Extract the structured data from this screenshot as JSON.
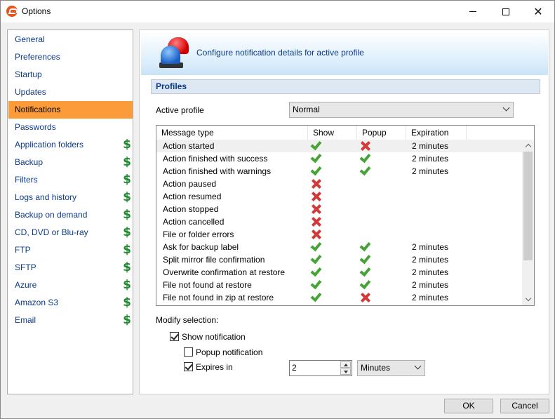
{
  "window": {
    "title": "Options"
  },
  "nav": {
    "items": [
      {
        "label": "General",
        "paid": false,
        "selected": false
      },
      {
        "label": "Preferences",
        "paid": false,
        "selected": false
      },
      {
        "label": "Startup",
        "paid": false,
        "selected": false
      },
      {
        "label": "Updates",
        "paid": false,
        "selected": false
      },
      {
        "label": "Notifications",
        "paid": false,
        "selected": true
      },
      {
        "label": "Passwords",
        "paid": false,
        "selected": false
      },
      {
        "label": "Application folders",
        "paid": true,
        "selected": false
      },
      {
        "label": "Backup",
        "paid": true,
        "selected": false
      },
      {
        "label": "Filters",
        "paid": true,
        "selected": false
      },
      {
        "label": "Logs and history",
        "paid": true,
        "selected": false
      },
      {
        "label": "Backup on demand",
        "paid": true,
        "selected": false
      },
      {
        "label": "CD, DVD or Blu-ray",
        "paid": true,
        "selected": false
      },
      {
        "label": "FTP",
        "paid": true,
        "selected": false
      },
      {
        "label": "SFTP",
        "paid": true,
        "selected": false
      },
      {
        "label": "Azure",
        "paid": true,
        "selected": false
      },
      {
        "label": "Amazon S3",
        "paid": true,
        "selected": false
      },
      {
        "label": "Email",
        "paid": true,
        "selected": false
      }
    ],
    "paid_symbol": "$"
  },
  "banner": {
    "icon": "siren-icon",
    "text": "Configure notification details for active profile"
  },
  "profiles": {
    "section_title": "Profiles",
    "active_profile_label": "Active profile",
    "active_profile_value": "Normal"
  },
  "table": {
    "columns": [
      "Message type",
      "Show",
      "Popup",
      "Expiration"
    ],
    "rows": [
      {
        "type": "Action started",
        "show": "check",
        "popup": "cross",
        "expiration": "2 minutes",
        "highlight": true
      },
      {
        "type": "Action finished with success",
        "show": "check",
        "popup": "check",
        "expiration": "2 minutes"
      },
      {
        "type": "Action finished with warnings",
        "show": "check",
        "popup": "check",
        "expiration": "2 minutes"
      },
      {
        "type": "Action paused",
        "show": "cross",
        "popup": "",
        "expiration": ""
      },
      {
        "type": "Action resumed",
        "show": "cross",
        "popup": "",
        "expiration": ""
      },
      {
        "type": "Action stopped",
        "show": "cross",
        "popup": "",
        "expiration": ""
      },
      {
        "type": "Action cancelled",
        "show": "cross",
        "popup": "",
        "expiration": ""
      },
      {
        "type": "File or folder errors",
        "show": "cross",
        "popup": "",
        "expiration": ""
      },
      {
        "type": "Ask for backup label",
        "show": "check",
        "popup": "check",
        "expiration": "2 minutes"
      },
      {
        "type": "Split mirror file confirmation",
        "show": "check",
        "popup": "check",
        "expiration": "2 minutes"
      },
      {
        "type": "Overwrite confirmation at restore",
        "show": "check",
        "popup": "check",
        "expiration": "2 minutes"
      },
      {
        "type": "File not found at restore",
        "show": "check",
        "popup": "check",
        "expiration": "2 minutes"
      },
      {
        "type": "File not found in zip at restore",
        "show": "check",
        "popup": "cross",
        "expiration": "2 minutes"
      }
    ]
  },
  "modify": {
    "label": "Modify selection:",
    "show_notification": {
      "label": "Show notification",
      "checked": true
    },
    "popup_notification": {
      "label": "Popup notification",
      "checked": false
    },
    "expires_in": {
      "label": "Expires in",
      "checked": true,
      "value": "2",
      "unit": "Minutes"
    }
  },
  "buttons": {
    "ok": "OK",
    "cancel": "Cancel"
  },
  "colors": {
    "selected_nav": "#fb9b3a",
    "link_blue": "#0b3a8a",
    "dollar_green": "#1e8b2e",
    "check_green": "#46a336",
    "cross_red": "#d23a3a"
  }
}
